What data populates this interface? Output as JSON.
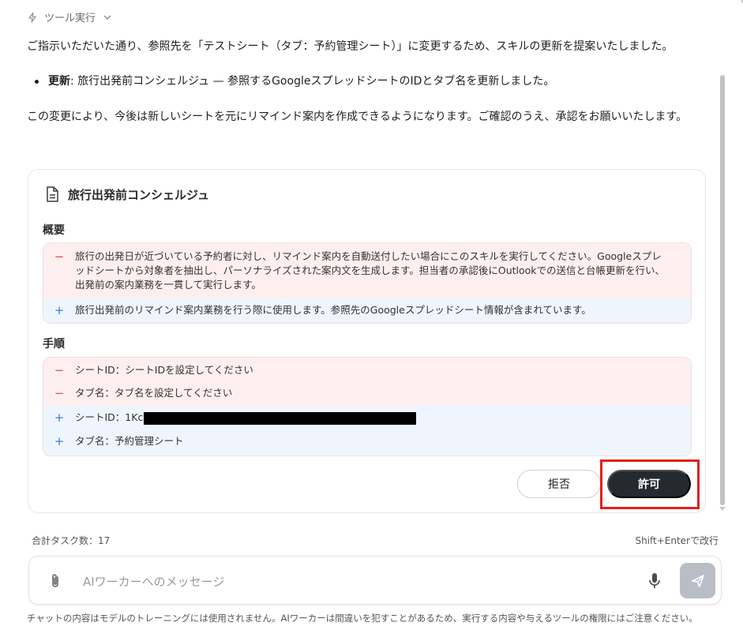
{
  "tool_header": {
    "label": "ツール実行",
    "icon": "lightning-icon"
  },
  "message": {
    "intro": "ご指示いただいた通り、参照先を「テストシート（タブ：予約管理シート）」に変更するため、スキルの更新を提案いたしました。",
    "bullet_label": "更新",
    "bullet_text": ": 旅行出発前コンシェルジュ — 参照するGoogleスプレッドシートのIDとタブ名を更新しました。",
    "outro": "この変更により、今後は新しいシートを元にリマインド案内を作成できるようになります。ご確認のうえ、承認をお願いいたします。"
  },
  "card": {
    "title": "旅行出発前コンシェルジュ",
    "summary_label": "概要",
    "summary_removed_lines": [
      "旅行の出発日が近づいている予約者に対し、リマインド案内を自動送付したい場合にこのスキルを実行してください。Googleスプレ",
      "ッドシートから対象者を抽出し、パーソナライズされた案内文を生成します。担当者の承認後にOutlookでの送信と台帳更新を行い、",
      "出発前の案内業務を一貫して実行します。"
    ],
    "summary_added": "旅行出発前のリマインド案内業務を行う際に使用します。参照先のGoogleスプレッドシート情報が含まれています。",
    "steps_label": "手順",
    "steps_removed": [
      "シートID：シートIDを設定してください",
      "タブ名：タブ名を設定してください"
    ],
    "steps_added_sheet": "シートID：1Kc",
    "steps_added_tab": "タブ名：予約管理シート",
    "reject_label": "拒否",
    "allow_label": "許可"
  },
  "footer": {
    "total_tasks": "合計タスク数：17",
    "newline_hint": "Shift+Enterで改行",
    "input_placeholder": "AIワーカーへのメッセージ",
    "disclaimer": "チャットの内容はモデルのトレーニングには使用されません。AIワーカーは間違いを犯すことがあるため、実行する内容や与えるツールの権限にはご注意ください。"
  },
  "colors": {
    "allow_bg": "#252a31",
    "highlight": "#e02020",
    "removed_bg": "#fdeff0",
    "added_bg": "#eef5fd"
  }
}
